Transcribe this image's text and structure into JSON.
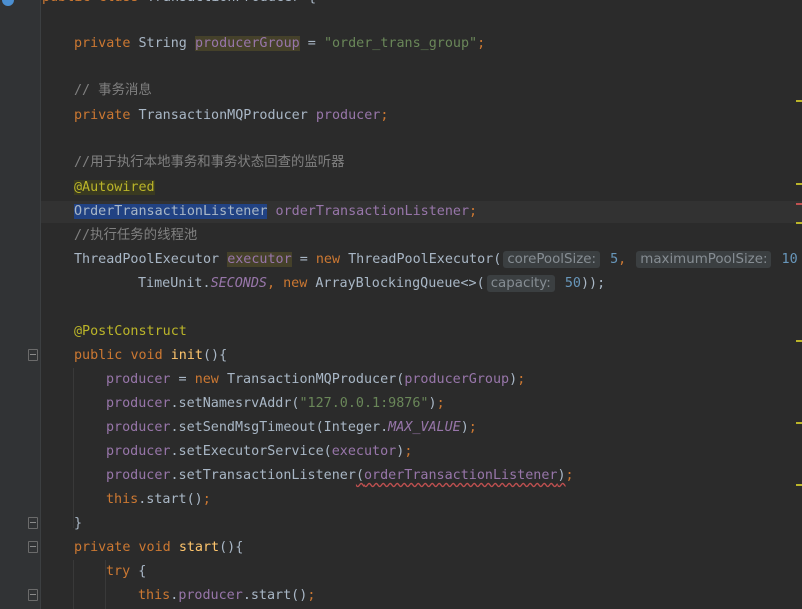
{
  "editor": {
    "lines": [
      {
        "id": "l0",
        "segments": [
          [
            "kw",
            "public "
          ],
          [
            "kw",
            "class "
          ],
          [
            "plain",
            "TransactionProducer {"
          ]
        ]
      },
      {
        "id": "l1",
        "segments": [
          [
            "kw",
            "private "
          ],
          [
            "plain",
            "String "
          ],
          [
            "field hl-field",
            "producerGroup"
          ],
          [
            "plain",
            " = "
          ],
          [
            "str",
            "\"order_trans_group\""
          ],
          [
            "kw",
            ";"
          ]
        ]
      },
      {
        "id": "l2",
        "segments": [
          [
            "cmt",
            "// 事务消息"
          ]
        ]
      },
      {
        "id": "l3",
        "segments": [
          [
            "kw",
            "private "
          ],
          [
            "plain",
            "TransactionMQProducer "
          ],
          [
            "field",
            "producer"
          ],
          [
            "kw",
            ";"
          ]
        ]
      },
      {
        "id": "l4",
        "segments": [
          [
            "cmt",
            "//用于执行本地事务和事务状态回查的监听器"
          ]
        ]
      },
      {
        "id": "l5",
        "segments": [
          [
            "ann hl-ann",
            "@Autowired"
          ]
        ]
      },
      {
        "id": "l6",
        "segments": [
          [
            "plain hl-sel",
            "OrderTransactionListener"
          ],
          [
            "plain",
            " "
          ],
          [
            "field",
            "orderTransactionListener"
          ],
          [
            "kw",
            ";"
          ]
        ]
      },
      {
        "id": "l7",
        "segments": [
          [
            "cmt",
            "//执行任务的线程池"
          ]
        ]
      },
      {
        "id": "l8",
        "segments": [
          [
            "plain",
            "ThreadPoolExecutor "
          ],
          [
            "field hl-field",
            "executor"
          ],
          [
            "plain",
            " = "
          ],
          [
            "kw",
            "new "
          ],
          [
            "plain",
            "ThreadPoolExecutor("
          ],
          [
            "hint",
            "corePoolSize:"
          ],
          [
            "num",
            " 5"
          ],
          [
            "kw",
            ", "
          ],
          [
            "hint",
            "maximumPoolSize:"
          ],
          [
            "num",
            " 10"
          ]
        ]
      },
      {
        "id": "l9",
        "segments": [
          [
            "plain",
            "TimeUnit."
          ],
          [
            "field italic",
            "SECONDS"
          ],
          [
            "kw",
            ", "
          ],
          [
            "kw",
            "new "
          ],
          [
            "plain",
            "ArrayBlockingQueue<>("
          ],
          [
            "hint",
            "capacity:"
          ],
          [
            "num",
            " 50"
          ],
          [
            "plain",
            "));"
          ]
        ]
      },
      {
        "id": "l10",
        "segments": [
          [
            "ann",
            "@PostConstruct"
          ]
        ]
      },
      {
        "id": "l11",
        "segments": [
          [
            "kw",
            "public "
          ],
          [
            "kw",
            "void "
          ],
          [
            "fn",
            "init"
          ],
          [
            "plain",
            "(){"
          ]
        ]
      },
      {
        "id": "l12",
        "segments": [
          [
            "field",
            "producer"
          ],
          [
            "plain",
            " = "
          ],
          [
            "kw",
            "new "
          ],
          [
            "plain",
            "TransactionMQProducer("
          ],
          [
            "field",
            "producerGroup"
          ],
          [
            "plain",
            ")"
          ],
          [
            "kw",
            ";"
          ]
        ]
      },
      {
        "id": "l13",
        "segments": [
          [
            "field",
            "producer"
          ],
          [
            "plain",
            ".setNamesrvAddr("
          ],
          [
            "str",
            "\"127.0.0.1:9876\""
          ],
          [
            "plain",
            ")"
          ],
          [
            "kw",
            ";"
          ]
        ]
      },
      {
        "id": "l14",
        "segments": [
          [
            "field",
            "producer"
          ],
          [
            "plain",
            ".setSendMsgTimeout(Integer."
          ],
          [
            "field italic",
            "MAX_VALUE"
          ],
          [
            "plain",
            ")"
          ],
          [
            "kw",
            ";"
          ]
        ]
      },
      {
        "id": "l15",
        "segments": [
          [
            "field",
            "producer"
          ],
          [
            "plain",
            ".setExecutorService("
          ],
          [
            "field",
            "executor"
          ],
          [
            "plain",
            ")"
          ],
          [
            "kw",
            ";"
          ]
        ]
      },
      {
        "id": "l16",
        "segments": [
          [
            "field",
            "producer"
          ],
          [
            "plain",
            ".setTransactionListener"
          ],
          [
            "underline-err",
            "("
          ],
          [
            "field underline-err",
            "orderTransactionListener"
          ],
          [
            "underline-err",
            ")"
          ],
          [
            "kw",
            ";"
          ]
        ]
      },
      {
        "id": "l17",
        "segments": [
          [
            "kw",
            "this"
          ],
          [
            "plain",
            ".start()"
          ],
          [
            "kw",
            ";"
          ]
        ]
      },
      {
        "id": "l18",
        "segments": [
          [
            "plain",
            "}"
          ]
        ]
      },
      {
        "id": "l19",
        "segments": [
          [
            "kw",
            "private "
          ],
          [
            "kw",
            "void "
          ],
          [
            "fn",
            "start"
          ],
          [
            "plain",
            "(){"
          ]
        ]
      },
      {
        "id": "l20",
        "segments": [
          [
            "kw",
            "try "
          ],
          [
            "plain",
            "{"
          ]
        ]
      },
      {
        "id": "l21",
        "segments": [
          [
            "kw",
            "this"
          ],
          [
            "plain",
            "."
          ],
          [
            "field",
            "producer"
          ],
          [
            "plain",
            ".start()"
          ],
          [
            "kw",
            ";"
          ]
        ]
      }
    ],
    "colors": {
      "background": "#2b2b2b",
      "keyword": "#cc7832",
      "string": "#6a8759",
      "field": "#9876aa",
      "comment": "#808080",
      "annotation": "#bbb529",
      "number": "#6897bb",
      "selection": "#214283"
    }
  }
}
